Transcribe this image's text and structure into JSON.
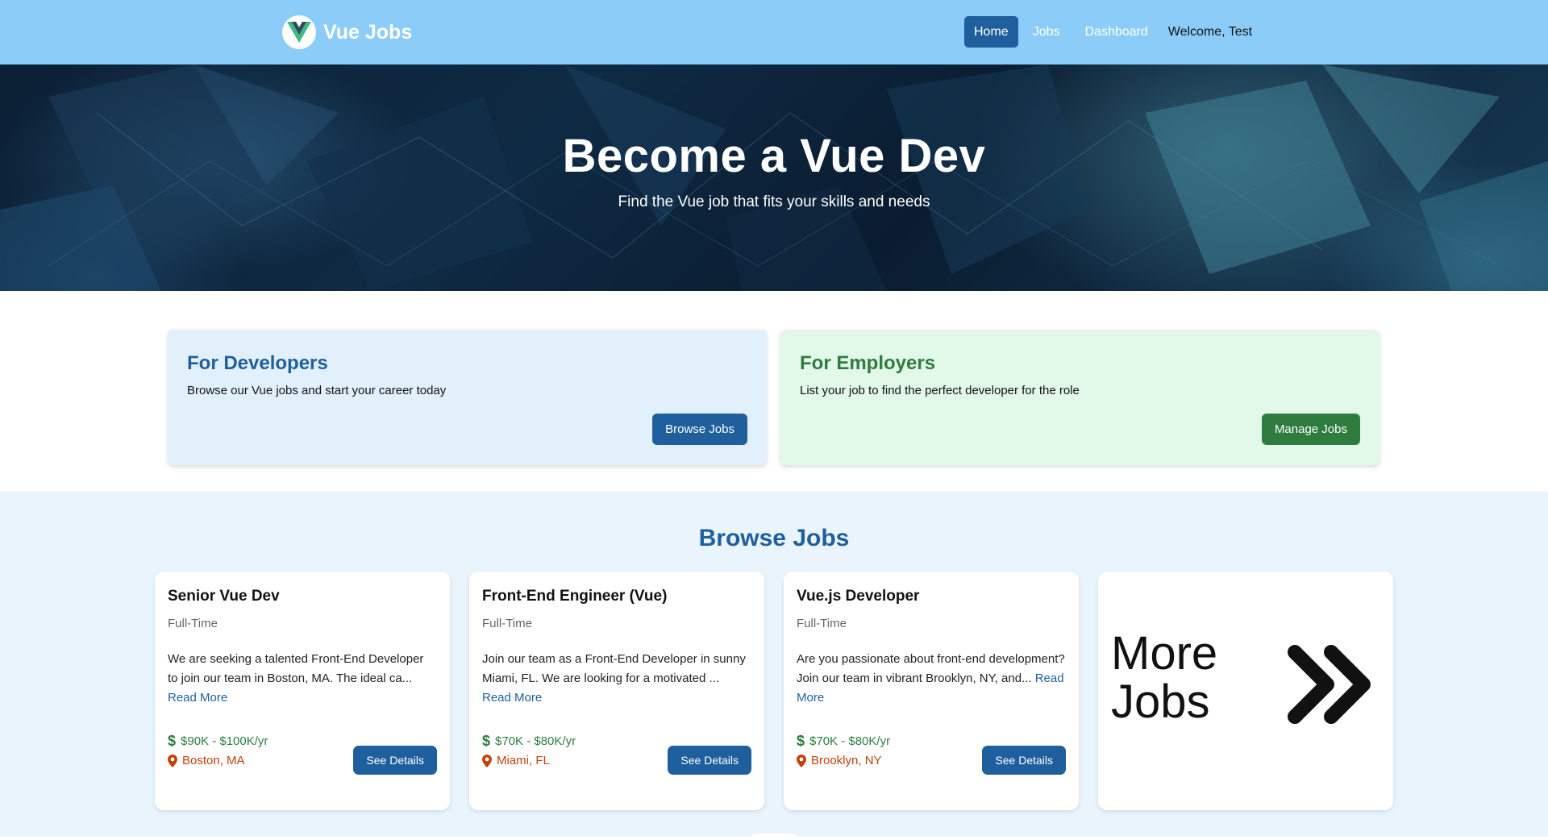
{
  "brand": {
    "name": "Vue Jobs",
    "logo_icon": "vue-logo-icon"
  },
  "nav": {
    "links": [
      "Home",
      "Jobs",
      "Dashboard"
    ],
    "active": "Home",
    "welcome": "Welcome, Test"
  },
  "hero": {
    "title": "Become a Vue Dev",
    "subtitle": "Find the Vue job that fits your skills and needs"
  },
  "audience": {
    "developers": {
      "title": "For Developers",
      "text": "Browse our Vue jobs and start your career today",
      "button": "Browse Jobs"
    },
    "employers": {
      "title": "For Employers",
      "text": "List your job to find the perfect developer for the role",
      "button": "Manage Jobs"
    }
  },
  "jobs": {
    "heading": "Browse Jobs",
    "read_more": "Read More",
    "details_button": "See Details",
    "items": [
      {
        "title": "Senior Vue Dev",
        "type": "Full-Time",
        "description": "We are seeking a talented Front-End Developer to join our team in Boston, MA. The ideal ca...",
        "salary": "$90K - $100K/yr",
        "location": "Boston, MA"
      },
      {
        "title": "Front-End Engineer (Vue)",
        "type": "Full-Time",
        "description": "Join our team as a Front-End Developer in sunny Miami, FL. We are looking for a motivated ...",
        "salary": "$70K - $80K/yr",
        "location": "Miami, FL"
      },
      {
        "title": "Vue.js Developer",
        "type": "Full-Time",
        "description": "Are you passionate about front-end development? Join our team in vibrant Brooklyn, NY, and...",
        "salary": "$70K - $80K/yr",
        "location": "Brooklyn, NY"
      }
    ],
    "more_label": "More Jobs"
  },
  "colors": {
    "navbar": "#8bcdf8",
    "primary": "#1f5f9e",
    "success": "#2e7d3e",
    "location": "#c2410c",
    "jobs_bg": "#eaf4fd"
  }
}
